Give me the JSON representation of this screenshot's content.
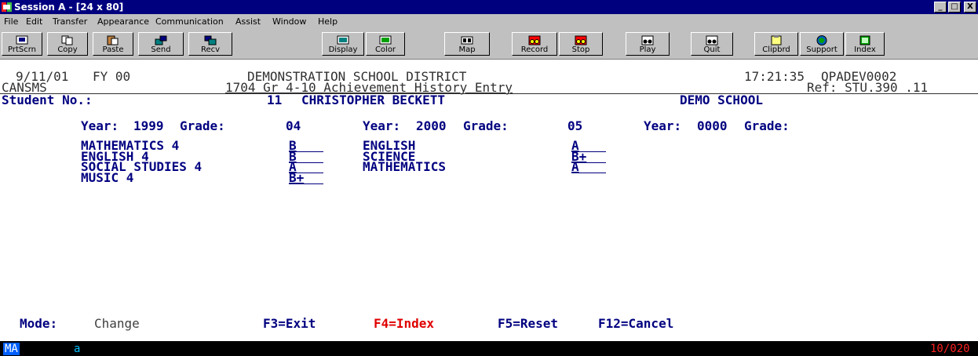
{
  "window": {
    "title": "Session A - [24 x 80]",
    "controls": [
      "_",
      "□",
      "X"
    ]
  },
  "menu": [
    "File",
    "Edit",
    "Transfer",
    "Appearance",
    "Communication",
    "Assist",
    "Window",
    "Help"
  ],
  "toolbar": [
    {
      "label": "PrtScrn",
      "icon": "print-screen-icon"
    },
    {
      "label": "Copy",
      "icon": "copy-icon"
    },
    {
      "label": "Paste",
      "icon": "paste-icon"
    },
    {
      "label": "Send",
      "icon": "send-icon"
    },
    {
      "label": "Recv",
      "icon": "receive-icon"
    },
    {
      "label": "Display",
      "icon": "display-icon"
    },
    {
      "label": "Color",
      "icon": "color-icon"
    },
    {
      "label": "Map",
      "icon": "map-icon"
    },
    {
      "label": "Record",
      "icon": "record-icon"
    },
    {
      "label": "Stop",
      "icon": "stop-icon"
    },
    {
      "label": "Play",
      "icon": "play-icon"
    },
    {
      "label": "Quit",
      "icon": "quit-icon"
    },
    {
      "label": "Clipbrd",
      "icon": "clipboard-icon"
    },
    {
      "label": "Support",
      "icon": "support-icon"
    },
    {
      "label": "Index",
      "icon": "index-icon"
    }
  ],
  "screen": {
    "date": "9/11/01",
    "fiscal_year": "FY 00",
    "district": "DEMONSTRATION SCHOOL DISTRICT",
    "time": "17:21:35",
    "system_id": "QPADEV0002",
    "app": "CANSMS",
    "program_title": "1704 Gr 4-10 Achievement History Entry",
    "ref": "Ref: STU.390 .11",
    "student_label": "Student No.:",
    "student_number": "11",
    "student_name": "CHRISTOPHER BECKETT",
    "school": "DEMO SCHOOL",
    "year_blocks": [
      {
        "year_label": "Year:",
        "year": "1999",
        "grade_label": "Grade:",
        "grade": "04"
      },
      {
        "year_label": "Year:",
        "year": "2000",
        "grade_label": "Grade:",
        "grade": "05"
      },
      {
        "year_label": "Year:",
        "year": "0000",
        "grade_label": "Grade:",
        "grade": ""
      }
    ],
    "col1": [
      {
        "subject": "MATHEMATICS 4",
        "mark": "B"
      },
      {
        "subject": "ENGLISH 4",
        "mark": "B"
      },
      {
        "subject": "SOCIAL STUDIES 4",
        "mark": "A"
      },
      {
        "subject": "MUSIC 4",
        "mark": "B+"
      }
    ],
    "col2": [
      {
        "subject": "ENGLISH",
        "mark": "A"
      },
      {
        "subject": "SCIENCE",
        "mark": "B+"
      },
      {
        "subject": "MATHEMATICS",
        "mark": "A"
      }
    ],
    "mode_label": "Mode:",
    "mode_value": "Change",
    "fkeys": [
      "F3=Exit",
      "F4=Index",
      "F5=Reset",
      "F12=Cancel"
    ]
  },
  "status": {
    "indicator": "MA",
    "session": "a",
    "cursor": "10/020"
  },
  "colors": {
    "terminal_field": "#000080",
    "function_key_highlight": "#e00000",
    "title_bar": "#00007f"
  }
}
